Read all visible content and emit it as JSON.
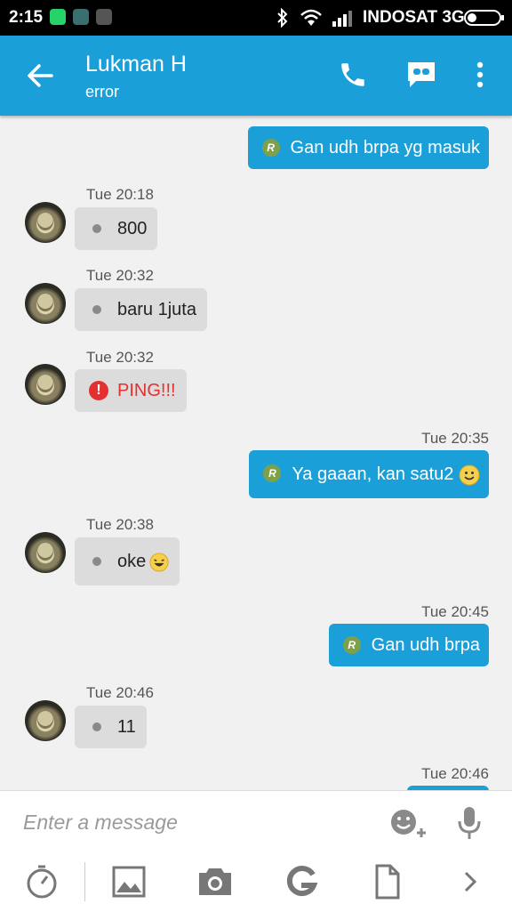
{
  "status_bar": {
    "time": "2:15",
    "carrier": "INDOSAT 3G",
    "icons": [
      "whatsapp-icon",
      "app-icon",
      "bbm-icon",
      "bluetooth-icon",
      "wifi-icon",
      "signal-icon",
      "battery-icon"
    ]
  },
  "header": {
    "title": "Lukman H",
    "subtitle": "error",
    "actions": [
      "back-arrow-icon",
      "phone-icon",
      "video-chat-icon",
      "more-vert-icon"
    ],
    "color": "#1b9fd8"
  },
  "messages": [
    {
      "direction": "out",
      "text": "Gan udh brpa yg masuk"
    },
    {
      "direction": "in",
      "time": "Tue 20:18",
      "text": "800"
    },
    {
      "direction": "in",
      "time": "Tue 20:32",
      "text": "baru 1juta"
    },
    {
      "direction": "in",
      "time": "Tue 20:32",
      "text": "PING!!!",
      "type": "ping"
    },
    {
      "direction": "out",
      "time": "Tue 20:35",
      "text": "Ya gaaan, kan satu2",
      "emoji": "smile"
    },
    {
      "direction": "in",
      "time": "Tue 20:38",
      "text": "oke",
      "emoji": "laugh"
    },
    {
      "direction": "out",
      "time": "Tue 20:45",
      "text": "Gan udh brpa"
    },
    {
      "direction": "in",
      "time": "Tue 20:46",
      "text": "11"
    },
    {
      "direction": "out",
      "time": "Tue 20:46",
      "text": ""
    }
  ],
  "read_badge": "R",
  "composer": {
    "placeholder": "Enter a message",
    "icons": [
      "emoji-add-icon",
      "mic-icon",
      "timer-icon",
      "image-icon",
      "camera-icon",
      "google-icon",
      "file-icon",
      "chevron-right-icon"
    ]
  },
  "colors": {
    "accent": "#1b9fd8",
    "incoming_bubble": "#dcdcdc",
    "ping": "#e53030",
    "badge": "#7da14b"
  }
}
